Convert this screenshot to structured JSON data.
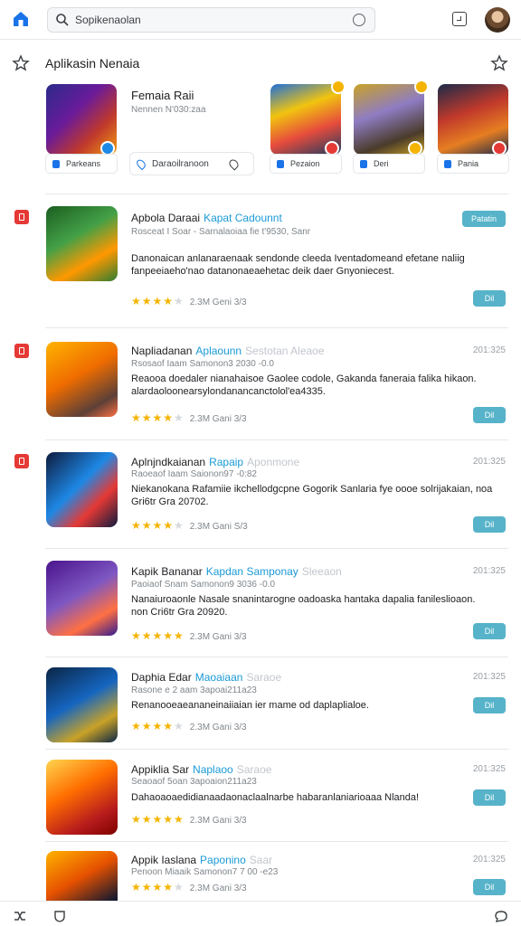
{
  "header": {
    "search_value": "Sopikenaolan",
    "search_placeholder": "Sopikenaolan"
  },
  "featured": {
    "section_title": "Aplikasin Nenaia",
    "mid_title": "Femaia Raii",
    "mid_subtitle": "Nennen N'030:zaa",
    "mid_chip": "Daraoilranoon",
    "cards": [
      {
        "label": "Parkeans",
        "colors": [
          "#2a2a8a",
          "#c0392b",
          "#f39c12"
        ],
        "badge": "#1e88e5"
      },
      {
        "label": "Pezaion",
        "colors": [
          "#1e6fd9",
          "#e74c3c",
          "#f1c40f"
        ],
        "badge": "#e53935",
        "corner": "#f5b400"
      },
      {
        "label": "Deri",
        "colors": [
          "#c9a227",
          "#4a3b2a",
          "#8e7cc3"
        ],
        "badge": "#f5b400",
        "corner": "#f5b400"
      },
      {
        "label": "Pania",
        "colors": [
          "#1b2a4a",
          "#c0392b",
          "#e67e22"
        ],
        "badge": "#e53935"
      }
    ]
  },
  "apps": [
    {
      "name": "Apbola Daraai",
      "developer": "Kapat Cadounnt",
      "category": "",
      "date": "",
      "meta": "Rosceat I Soar - Sarnalaoiaa fie t'9530, Sanr",
      "desc": "Danonaican anlanaraenaak sendonde cleeda Iventadomeand efetane naliig fanpeeiaeho'nao datanonaeaehetac deik daer Gnyoniecest.",
      "stars": 4,
      "rating_text": "2.3M Geni 3/3",
      "action": "Dil",
      "tag": "Patatin",
      "colors": [
        "#2e7d32",
        "#8bc34a",
        "#ff9800"
      ]
    },
    {
      "name": "Napliadanan",
      "developer": "Aplaounn",
      "category": "Sestotan Aleaoe",
      "date": "201:325",
      "meta": "Rsosaof Iaam Samonon3 2030 -0.0",
      "desc": "Reaooa doedaler nianahaisoe Gaolee codole, Gakanda faneraia falika hikaon. alardaoloonearsylondanancanctolol'ea4335.",
      "stars": 4,
      "rating_text": "2.3M Gani 3/3",
      "action": "Dil",
      "tag": "",
      "colors": [
        "#ef6c00",
        "#ffb300",
        "#5d4037"
      ]
    },
    {
      "name": "Aplnjndkaianan",
      "developer": "Rapaip",
      "category": "Aponmone",
      "date": "201:325",
      "meta": "Raoeaof Iaam Saionon97 -0:82",
      "desc": "Niekanokana Rafamiie ikchellodgcpne Gogorik Sanlaria fye oooe solrijakaian, noa Gri6tr Gra 20702.",
      "stars": 4,
      "rating_text": "2.3M Gani S/3",
      "action": "Dil",
      "tag": "",
      "colors": [
        "#0d1b3e",
        "#e53935",
        "#1e88e5"
      ]
    },
    {
      "name": "Kapik Bananar",
      "developer": "Kapdan Samponay",
      "category": "Sleeaon",
      "date": "201:325",
      "meta": "Paoiaof Snam Samonon9 3036 -0.0",
      "desc": "Nanaiuroaonle Nasale snanintarogne oadoaska hantaka dapalia fanileslioaon. non Cri6tr Gra 20920.",
      "stars": 5,
      "rating_text": "2.3M Gani 3/3",
      "action": "Dil",
      "tag": "",
      "colors": [
        "#4a148c",
        "#7e57c2",
        "#ff7043"
      ]
    },
    {
      "name": "Daphia Edar",
      "developer": "Maoaiaan",
      "category": "Saraoe",
      "date": "201:325",
      "meta": "Rasone e 2 aam 3apoai211a23",
      "desc": "Renanooeaeananeinaiiaian ier mame od daplaplialoe.",
      "stars": 4,
      "rating_text": "2.3M Gani 3/3",
      "action": "Dil",
      "tag": "",
      "colors": [
        "#0b2545",
        "#1565c0",
        "#c9a227"
      ]
    },
    {
      "name": "Appiklia Sar",
      "developer": "Naplaoo",
      "category": "Saraoe",
      "date": "201:325",
      "meta": "Seaoaof 5oan 3apoaion211a23",
      "desc": "Dahaoaoaedidianaadaonaclaalnarbe habaranlaniarioaaa Nlanda!",
      "stars": 5,
      "rating_text": "2.3M Gani 3/3",
      "action": "Dil",
      "tag": "",
      "colors": [
        "#b71c1c",
        "#ff6f00",
        "#ffd54f"
      ]
    },
    {
      "name": "Appik Iaslana",
      "developer": "Paponino",
      "category": "Saar",
      "date": "201:325",
      "meta": "Penoon Miaaik Samonon7 7 00 -e23",
      "desc": "",
      "stars": 4,
      "rating_text": "2.3M Gani 3/3",
      "action": "Dil",
      "tag": "",
      "colors": [
        "#1a1a2e",
        "#e65100",
        "#ffb300"
      ]
    }
  ]
}
